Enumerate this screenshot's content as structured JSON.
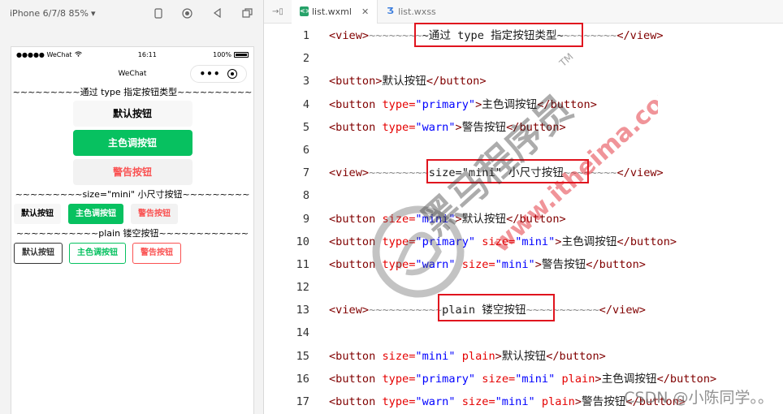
{
  "simulator": {
    "device": "iPhone 6/7/8 85%",
    "toolbar_icons": [
      "device-icon",
      "record-icon",
      "back-icon",
      "copy-window-icon"
    ],
    "status_bar": {
      "carrier": "●●●●● WeChat",
      "time": "16:11",
      "battery": "100%"
    },
    "nav_title": "WeChat",
    "capsule": {
      "more": "•••"
    },
    "section1": "~~~~~~~~~通过 type 指定按钮类型~~~~~~~~~~",
    "section2": "~~~~~~~~~size=\"mini\" 小尺寸按钮~~~~~~~~~",
    "section3": "~~~~~~~~~~~plain 镂空按钮~~~~~~~~~~~~",
    "big_buttons": {
      "default": "默认按钮",
      "primary": "主色调按钮",
      "warn": "警告按钮"
    },
    "mini_buttons": {
      "default": "默认按钮",
      "primary": "主色调按钮",
      "warn": "警告按钮"
    },
    "plain_buttons": {
      "default": "默认按钮",
      "primary": "主色调按钮",
      "warn": "警告按钮"
    }
  },
  "editor": {
    "split_icon": "→▯",
    "tabs": [
      {
        "label": "list.wxml",
        "icon": "wxml-file-icon",
        "active": true,
        "close": "✕"
      },
      {
        "label": "list.wxss",
        "icon": "wxss-file-icon",
        "active": false
      }
    ],
    "lines": [
      {
        "n": "1"
      },
      {
        "n": "2"
      },
      {
        "n": "3"
      },
      {
        "n": "4"
      },
      {
        "n": "5"
      },
      {
        "n": "6"
      },
      {
        "n": "7"
      },
      {
        "n": "8"
      },
      {
        "n": "9"
      },
      {
        "n": "10"
      },
      {
        "n": "11"
      },
      {
        "n": "12"
      },
      {
        "n": "13"
      },
      {
        "n": "14"
      },
      {
        "n": "15"
      },
      {
        "n": "16"
      },
      {
        "n": "17"
      }
    ],
    "code": {
      "view_open": "<view>",
      "view_close": "</view>",
      "button_open": "<button",
      "button_plain_open": "<button>",
      "button_close": "</button>",
      "gt": ">",
      "tilde_a": "~~~~~~~~",
      "tilde_b": "~",
      "tilde_c": "~~~~~~~~",
      "l1_text": "通过 type 指定按钮类型",
      "l7_text": "size=\"mini\" 小尺寸按钮",
      "l13_text": "plain 镂空按钮",
      "type_attr": "type=",
      "size_attr": "size=",
      "plain_attr": "plain",
      "primary_val": "\"primary\"",
      "warn_val": "\"warn\"",
      "mini_val": "\"mini\"",
      "label_default": "默认按钮",
      "label_primary": "主色调按钮",
      "label_warn": "警告按钮",
      "tilde_l7a": "~~~~~~~~~",
      "tilde_l7b": "~~~~~~~~",
      "tilde_l13a": "~~~~~~~~~~~",
      "tilde_l13b": "~~~~~~~~~~~"
    }
  },
  "watermark": {
    "brand": "黑马程序员",
    "site": "www.itheima.com",
    "tm": "TM",
    "csdn": "CSDN @小陈同学。。"
  },
  "colors": {
    "wechat_green": "#07c160",
    "warn_red": "#fa5151",
    "highlight_red": "#e0141e",
    "tag_color": "#800000",
    "attr_color": "#e50000",
    "value_color": "#0000ff"
  }
}
